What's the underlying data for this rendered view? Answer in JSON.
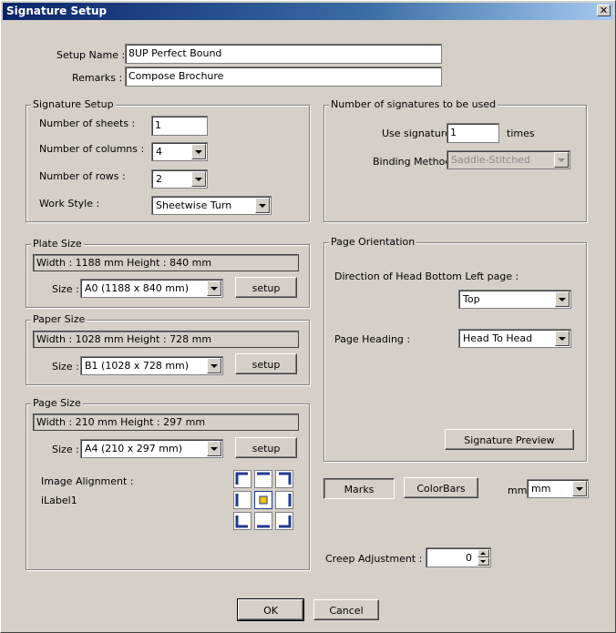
{
  "window": {
    "title": "Signature Setup"
  },
  "setup": {
    "name_label": "Setup Name :",
    "name_value": "8UP Perfect Bound",
    "remarks_label": "Remarks :",
    "remarks_value": "Compose Brochure"
  },
  "signature_setup": {
    "title": "Signature Setup",
    "sheets_label": "Number of sheets :",
    "sheets_value": "1",
    "columns_label": "Number of columns :",
    "columns_value": "4",
    "rows_label": "Number of rows :",
    "rows_value": "2",
    "workstyle_label": "Work Style :",
    "workstyle_value": "Sheetwise Turn"
  },
  "num_signatures": {
    "title": "Number of signatures to be used",
    "use_label": "Use signature",
    "use_value": "1",
    "times_label": "times",
    "binding_label": "Binding Method :",
    "binding_value": "Saddle-Stitched"
  },
  "plate_size": {
    "title": "Plate Size",
    "info": "Width : 1188 mm   Height : 840 mm",
    "size_label": "Size :",
    "size_value": "A0 (1188 x 840 mm)",
    "setup_label": "setup"
  },
  "paper_size": {
    "title": "Paper Size",
    "info": "Width : 1028 mm   Height : 728 mm",
    "size_label": "Size :",
    "size_value": "B1 (1028 x 728 mm)",
    "setup_label": "setup"
  },
  "page_size": {
    "title": "Page Size",
    "info": "Width : 210 mm    Height : 297 mm",
    "size_label": "Size :",
    "size_value": "A4 (210 x 297 mm)",
    "setup_label": "setup",
    "alignment_label": "Image Alignment :",
    "ilabel": "iLabel1"
  },
  "page_orientation": {
    "title": "Page Orientation",
    "direction_label": "Direction of Head Bottom Left page :",
    "direction_value": "Top",
    "heading_label": "Page Heading :",
    "heading_value": "Head To Head",
    "preview_label": "Signature Preview"
  },
  "bottom": {
    "marks_label": "Marks",
    "colorbars_label": "ColorBars",
    "unit_label": "mm",
    "unit_value": "mm",
    "creep_label": "Creep Adjustment :",
    "creep_value": "0",
    "ok_label": "OK",
    "cancel_label": "Cancel"
  },
  "colors": {
    "title_start": "#0a246a",
    "title_end": "#a6caf0",
    "align_blue": "#1f3a93",
    "align_center": "#f5c400"
  }
}
